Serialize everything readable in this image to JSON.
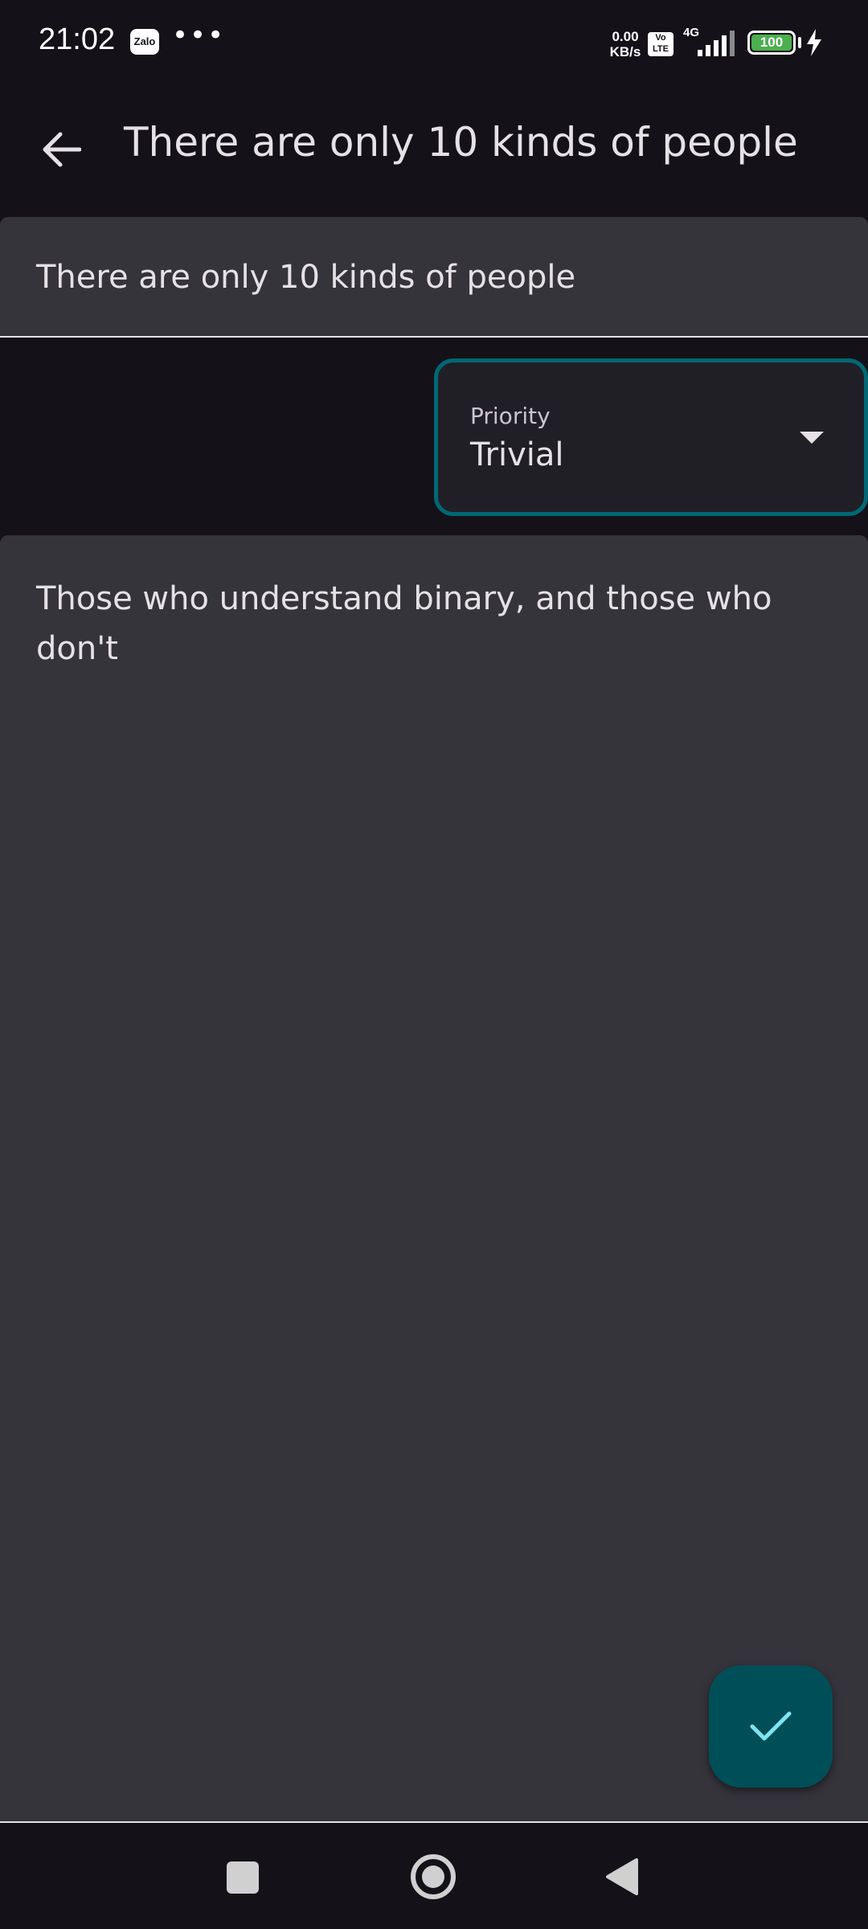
{
  "status_bar": {
    "time": "21:02",
    "zalo_label": "Zalo",
    "more_dots": "•••",
    "net_speed_value": "0.00",
    "net_speed_unit": "KB/s",
    "volte_line1": "Vo",
    "volte_line2": "LTE",
    "network_type": "4G",
    "battery_level": "100"
  },
  "app_bar": {
    "title": "There are only 10 kinds of people"
  },
  "form": {
    "title_value": "There are only 10 kinds of people",
    "priority_label": "Priority",
    "priority_value": "Trivial",
    "body_value": "Those who understand binary, and those who don't"
  },
  "colors": {
    "background": "#141218",
    "field_surface": "#36343b",
    "accent_outline": "#006874",
    "fab_background": "#004f58",
    "fab_icon": "#7fe3f0"
  },
  "icons": {
    "back": "arrow-back-icon",
    "dropdown": "dropdown-arrow-icon",
    "fab": "check-icon",
    "nav_recents": "square-icon",
    "nav_home": "circle-icon",
    "nav_back": "triangle-back-icon"
  }
}
